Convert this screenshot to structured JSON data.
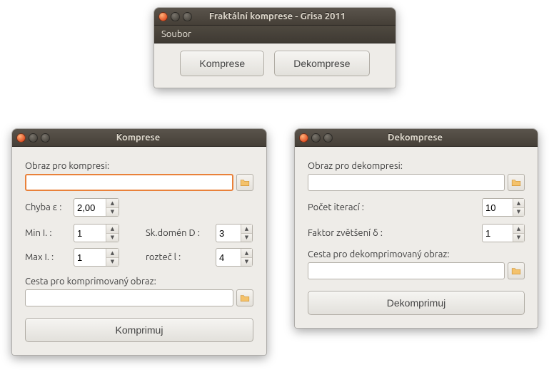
{
  "main": {
    "title": "Fraktální komprese - Grisa 2011",
    "menu_file": "Soubor",
    "btn_compress": "Komprese",
    "btn_decompress": "Dekomprese"
  },
  "komprese": {
    "title": "Komprese",
    "label_image": "Obraz pro kompresi:",
    "input_image": "",
    "label_error": "Chyba ε :",
    "error": "2,00",
    "label_min": "Min I. :",
    "min": "1",
    "label_domain": "Sk.domén D :",
    "domain": "3",
    "label_max": "Max I. :",
    "max": "1",
    "label_step": "rozteč l :",
    "step": "4",
    "label_out": "Cesta pro komprimovaný obraz:",
    "out": "",
    "btn": "Komprimuj"
  },
  "dekomprese": {
    "title": "Dekomprese",
    "label_image": "Obraz pro dekompresi:",
    "input_image": "",
    "label_iter": "Počet iterací :",
    "iter": "10",
    "label_zoom": "Faktor zvětšení δ :",
    "zoom": "1",
    "label_out": "Cesta pro dekomprimovaný obraz:",
    "out": "",
    "btn": "Dekomprimuj"
  }
}
